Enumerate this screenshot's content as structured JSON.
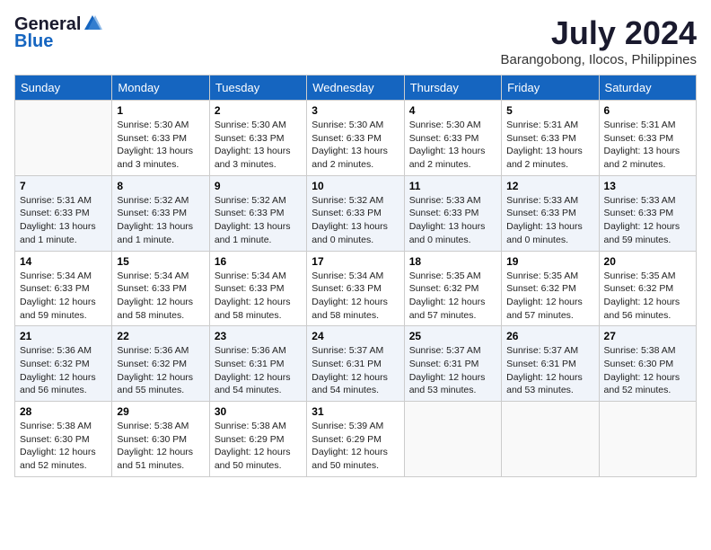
{
  "header": {
    "logo_general": "General",
    "logo_blue": "Blue",
    "month_title": "July 2024",
    "location": "Barangobong, Ilocos, Philippines"
  },
  "weekdays": [
    "Sunday",
    "Monday",
    "Tuesday",
    "Wednesday",
    "Thursday",
    "Friday",
    "Saturday"
  ],
  "weeks": [
    [
      {
        "day": "",
        "info": ""
      },
      {
        "day": "1",
        "info": "Sunrise: 5:30 AM\nSunset: 6:33 PM\nDaylight: 13 hours\nand 3 minutes."
      },
      {
        "day": "2",
        "info": "Sunrise: 5:30 AM\nSunset: 6:33 PM\nDaylight: 13 hours\nand 3 minutes."
      },
      {
        "day": "3",
        "info": "Sunrise: 5:30 AM\nSunset: 6:33 PM\nDaylight: 13 hours\nand 2 minutes."
      },
      {
        "day": "4",
        "info": "Sunrise: 5:30 AM\nSunset: 6:33 PM\nDaylight: 13 hours\nand 2 minutes."
      },
      {
        "day": "5",
        "info": "Sunrise: 5:31 AM\nSunset: 6:33 PM\nDaylight: 13 hours\nand 2 minutes."
      },
      {
        "day": "6",
        "info": "Sunrise: 5:31 AM\nSunset: 6:33 PM\nDaylight: 13 hours\nand 2 minutes."
      }
    ],
    [
      {
        "day": "7",
        "info": "Sunrise: 5:31 AM\nSunset: 6:33 PM\nDaylight: 13 hours\nand 1 minute."
      },
      {
        "day": "8",
        "info": "Sunrise: 5:32 AM\nSunset: 6:33 PM\nDaylight: 13 hours\nand 1 minute."
      },
      {
        "day": "9",
        "info": "Sunrise: 5:32 AM\nSunset: 6:33 PM\nDaylight: 13 hours\nand 1 minute."
      },
      {
        "day": "10",
        "info": "Sunrise: 5:32 AM\nSunset: 6:33 PM\nDaylight: 13 hours\nand 0 minutes."
      },
      {
        "day": "11",
        "info": "Sunrise: 5:33 AM\nSunset: 6:33 PM\nDaylight: 13 hours\nand 0 minutes."
      },
      {
        "day": "12",
        "info": "Sunrise: 5:33 AM\nSunset: 6:33 PM\nDaylight: 13 hours\nand 0 minutes."
      },
      {
        "day": "13",
        "info": "Sunrise: 5:33 AM\nSunset: 6:33 PM\nDaylight: 12 hours\nand 59 minutes."
      }
    ],
    [
      {
        "day": "14",
        "info": "Sunrise: 5:34 AM\nSunset: 6:33 PM\nDaylight: 12 hours\nand 59 minutes."
      },
      {
        "day": "15",
        "info": "Sunrise: 5:34 AM\nSunset: 6:33 PM\nDaylight: 12 hours\nand 58 minutes."
      },
      {
        "day": "16",
        "info": "Sunrise: 5:34 AM\nSunset: 6:33 PM\nDaylight: 12 hours\nand 58 minutes."
      },
      {
        "day": "17",
        "info": "Sunrise: 5:34 AM\nSunset: 6:33 PM\nDaylight: 12 hours\nand 58 minutes."
      },
      {
        "day": "18",
        "info": "Sunrise: 5:35 AM\nSunset: 6:32 PM\nDaylight: 12 hours\nand 57 minutes."
      },
      {
        "day": "19",
        "info": "Sunrise: 5:35 AM\nSunset: 6:32 PM\nDaylight: 12 hours\nand 57 minutes."
      },
      {
        "day": "20",
        "info": "Sunrise: 5:35 AM\nSunset: 6:32 PM\nDaylight: 12 hours\nand 56 minutes."
      }
    ],
    [
      {
        "day": "21",
        "info": "Sunrise: 5:36 AM\nSunset: 6:32 PM\nDaylight: 12 hours\nand 56 minutes."
      },
      {
        "day": "22",
        "info": "Sunrise: 5:36 AM\nSunset: 6:32 PM\nDaylight: 12 hours\nand 55 minutes."
      },
      {
        "day": "23",
        "info": "Sunrise: 5:36 AM\nSunset: 6:31 PM\nDaylight: 12 hours\nand 54 minutes."
      },
      {
        "day": "24",
        "info": "Sunrise: 5:37 AM\nSunset: 6:31 PM\nDaylight: 12 hours\nand 54 minutes."
      },
      {
        "day": "25",
        "info": "Sunrise: 5:37 AM\nSunset: 6:31 PM\nDaylight: 12 hours\nand 53 minutes."
      },
      {
        "day": "26",
        "info": "Sunrise: 5:37 AM\nSunset: 6:31 PM\nDaylight: 12 hours\nand 53 minutes."
      },
      {
        "day": "27",
        "info": "Sunrise: 5:38 AM\nSunset: 6:30 PM\nDaylight: 12 hours\nand 52 minutes."
      }
    ],
    [
      {
        "day": "28",
        "info": "Sunrise: 5:38 AM\nSunset: 6:30 PM\nDaylight: 12 hours\nand 52 minutes."
      },
      {
        "day": "29",
        "info": "Sunrise: 5:38 AM\nSunset: 6:30 PM\nDaylight: 12 hours\nand 51 minutes."
      },
      {
        "day": "30",
        "info": "Sunrise: 5:38 AM\nSunset: 6:29 PM\nDaylight: 12 hours\nand 50 minutes."
      },
      {
        "day": "31",
        "info": "Sunrise: 5:39 AM\nSunset: 6:29 PM\nDaylight: 12 hours\nand 50 minutes."
      },
      {
        "day": "",
        "info": ""
      },
      {
        "day": "",
        "info": ""
      },
      {
        "day": "",
        "info": ""
      }
    ]
  ]
}
